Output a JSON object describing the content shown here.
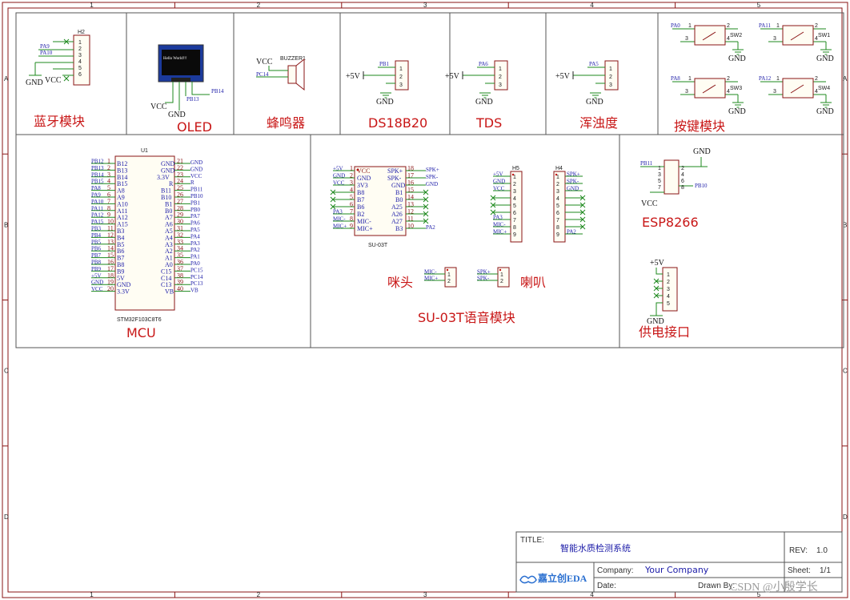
{
  "frame": {
    "cols": [
      "1",
      "2",
      "3",
      "4",
      "5"
    ],
    "rows": [
      "A",
      "B",
      "C",
      "D"
    ]
  },
  "blocks": {
    "bluetooth": {
      "title": "蓝牙模块",
      "ref": "H2",
      "pins": [
        "1",
        "2",
        "3",
        "4",
        "5",
        "6"
      ],
      "nets": [
        "PA9",
        "PA10",
        "GND",
        "VCC"
      ]
    },
    "oled": {
      "title": "OLED",
      "screen_text": "Hello World!!!",
      "nets": [
        "VCC",
        "GND",
        "PB13",
        "PB14"
      ]
    },
    "buzzer": {
      "title": "蜂鸣器",
      "ref": "BUZZER1",
      "nets": [
        "VCC",
        "PC14"
      ]
    },
    "ds18b20": {
      "title": "DS18B20",
      "pins": [
        "1",
        "2",
        "3"
      ],
      "nets": [
        "PB1",
        "+5V",
        "GND"
      ]
    },
    "tds": {
      "title": "TDS",
      "pins": [
        "1",
        "2",
        "3"
      ],
      "nets": [
        "PA6",
        "+5V",
        "GND"
      ]
    },
    "turbidity": {
      "title": "浑浊度",
      "pins": [
        "1",
        "2",
        "3"
      ],
      "nets": [
        "PA5",
        "+5V",
        "GND"
      ]
    },
    "keys": {
      "title": "按键模块",
      "switches": [
        {
          "ref": "SW2",
          "net": "PA0",
          "pins": [
            "1",
            "2",
            "3",
            "4"
          ],
          "gnd": "GND"
        },
        {
          "ref": "SW1",
          "net": "PA11",
          "pins": [
            "1",
            "2",
            "3",
            "4"
          ],
          "gnd": "GND"
        },
        {
          "ref": "SW3",
          "net": "PA8",
          "pins": [
            "1",
            "2",
            "3",
            "4"
          ],
          "gnd": "GND"
        },
        {
          "ref": "SW4",
          "net": "PA12",
          "pins": [
            "1",
            "2",
            "3",
            "4"
          ],
          "gnd": "GND"
        }
      ]
    },
    "mcu": {
      "title": "MCU",
      "ref": "U1",
      "part": "STM32F103C8T6",
      "left": [
        {
          "net": "PB12",
          "num": "1",
          "name": "B12"
        },
        {
          "net": "PB13",
          "num": "2",
          "name": "B13"
        },
        {
          "net": "PB14",
          "num": "3",
          "name": "B14"
        },
        {
          "net": "PB15",
          "num": "4",
          "name": "B15"
        },
        {
          "net": "PA8",
          "num": "5",
          "name": "A8"
        },
        {
          "net": "PA9",
          "num": "6",
          "name": "A9"
        },
        {
          "net": "PA10",
          "num": "7",
          "name": "A10"
        },
        {
          "net": "PA11",
          "num": "8",
          "name": "A11"
        },
        {
          "net": "PA12",
          "num": "9",
          "name": "A12"
        },
        {
          "net": "PA15",
          "num": "10",
          "name": "A15"
        },
        {
          "net": "PB3",
          "num": "11",
          "name": "B3"
        },
        {
          "net": "PB4",
          "num": "12",
          "name": "B4"
        },
        {
          "net": "PB5",
          "num": "13",
          "name": "B5"
        },
        {
          "net": "PB6",
          "num": "14",
          "name": "B6"
        },
        {
          "net": "PB7",
          "num": "15",
          "name": "B7"
        },
        {
          "net": "PB8",
          "num": "16",
          "name": "B8"
        },
        {
          "net": "PB9",
          "num": "17",
          "name": "B9"
        },
        {
          "net": "+5V",
          "num": "18",
          "name": "5V"
        },
        {
          "net": "GND",
          "num": "19",
          "name": "GND"
        },
        {
          "net": "VCC",
          "num": "20",
          "name": "3.3V"
        }
      ],
      "right": [
        {
          "net": "GND",
          "num": "21",
          "name": "GND"
        },
        {
          "net": "GND",
          "num": "22",
          "name": "GND"
        },
        {
          "net": "VCC",
          "num": "23",
          "name": "3.3V"
        },
        {
          "net": "R",
          "num": "24",
          "name": "R"
        },
        {
          "net": "PB11",
          "num": "25",
          "name": "B11"
        },
        {
          "net": "PB10",
          "num": "26",
          "name": "B10"
        },
        {
          "net": "PB1",
          "num": "27",
          "name": "B1"
        },
        {
          "net": "PB0",
          "num": "28",
          "name": "B0"
        },
        {
          "net": "PA7",
          "num": "29",
          "name": "A7"
        },
        {
          "net": "PA6",
          "num": "30",
          "name": "A6"
        },
        {
          "net": "PA5",
          "num": "31",
          "name": "A5"
        },
        {
          "net": "PA4",
          "num": "32",
          "name": "A4"
        },
        {
          "net": "PA3",
          "num": "33",
          "name": "A3"
        },
        {
          "net": "PA2",
          "num": "34",
          "name": "A2"
        },
        {
          "net": "PA1",
          "num": "35",
          "name": "A1"
        },
        {
          "net": "PA0",
          "num": "36",
          "name": "A0"
        },
        {
          "net": "PC15",
          "num": "37",
          "name": "C15"
        },
        {
          "net": "PC14",
          "num": "38",
          "name": "C14"
        },
        {
          "net": "PC13",
          "num": "39",
          "name": "C13"
        },
        {
          "net": "VB",
          "num": "40",
          "name": "VB"
        }
      ]
    },
    "su03t": {
      "title": "SU-03T语音模块",
      "part": "SU-03T",
      "left": [
        {
          "net": "+5V",
          "num": "1",
          "name": "VCC"
        },
        {
          "net": "GND",
          "num": "2",
          "name": "GND"
        },
        {
          "net": "VCC",
          "num": "3",
          "name": "3V3"
        },
        {
          "net": "",
          "num": "4",
          "name": "B8"
        },
        {
          "net": "",
          "num": "5",
          "name": "B7"
        },
        {
          "net": "",
          "num": "6",
          "name": "B6"
        },
        {
          "net": "PA3",
          "num": "7",
          "name": "B2"
        },
        {
          "net": "MIC-",
          "num": "8",
          "name": "MIC-"
        },
        {
          "net": "MIC+",
          "num": "9",
          "name": "MIC+"
        }
      ],
      "right": [
        {
          "net": "SPK+",
          "num": "18",
          "name": "SPK+"
        },
        {
          "net": "SPK-",
          "num": "17",
          "name": "SPK-"
        },
        {
          "net": "GND",
          "num": "16",
          "name": "GND"
        },
        {
          "net": "",
          "num": "15",
          "name": "B1"
        },
        {
          "net": "",
          "num": "14",
          "name": "B0"
        },
        {
          "net": "",
          "num": "13",
          "name": "A25"
        },
        {
          "net": "",
          "num": "12",
          "name": "A26"
        },
        {
          "net": "",
          "num": "11",
          "name": "A27"
        },
        {
          "net": "PA2",
          "num": "10",
          "name": "B3"
        }
      ],
      "h5": {
        "ref": "H5",
        "nets": [
          "+5V",
          "GND",
          "VCC",
          "",
          "",
          "",
          "PA3",
          "MIC-",
          "MIC+"
        ],
        "pins": [
          "1",
          "2",
          "3",
          "4",
          "5",
          "6",
          "7",
          "8",
          "9"
        ]
      },
      "h4": {
        "ref": "H4",
        "nets": [
          "SPK+",
          "SPK-",
          "GND",
          "",
          "",
          "",
          "",
          "",
          "PA2"
        ],
        "pins": [
          "1",
          "2",
          "3",
          "4",
          "5",
          "6",
          "7",
          "8",
          "9"
        ]
      },
      "mic_title": "咪头",
      "mic_nets": [
        "MIC-",
        "MIC+"
      ],
      "mic_pins": [
        "1",
        "2"
      ],
      "spk_title": "喇叭",
      "spk_nets": [
        "SPK+",
        "SPK-"
      ],
      "spk_pins": [
        "1",
        "2"
      ]
    },
    "esp8266": {
      "title": "ESP8266",
      "pins_left": [
        "1",
        "3",
        "5",
        "7"
      ],
      "pins_right": [
        "2",
        "4",
        "6",
        "8"
      ],
      "nets": [
        "GND",
        "PB11",
        "PB10",
        "VCC"
      ]
    },
    "power": {
      "title": "供电接口",
      "pins": [
        "1",
        "2",
        "3",
        "4",
        "5"
      ],
      "nets": [
        "+5V",
        "GND"
      ]
    }
  },
  "titleblock": {
    "title_label": "TITLE:",
    "title": "智能水质检测系统",
    "rev_label": "REV:",
    "rev": "1.0",
    "company_label": "Company:",
    "company": "Your Company",
    "sheet_label": "Sheet:",
    "sheet": "1/1",
    "date_label": "Date:",
    "drawn_label": "Drawn By:",
    "logo": "嘉立创EDA",
    "watermark": "CSDN @小殷学长"
  }
}
